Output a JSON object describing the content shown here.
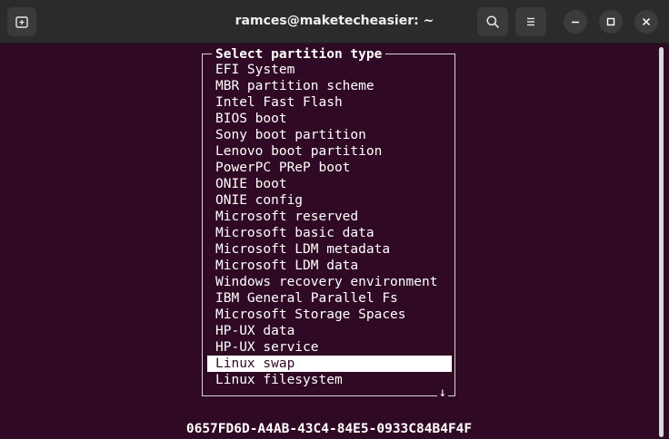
{
  "window": {
    "title": "ramces@maketecheasier: ~"
  },
  "toolbar": {
    "new_tab_icon": "new-tab-icon",
    "search_icon": "search-icon",
    "menu_icon": "hamburger-menu-icon",
    "minimize_icon": "minimize-icon",
    "maximize_icon": "maximize-icon",
    "close_icon": "close-icon"
  },
  "dialog": {
    "title": "Select partition type",
    "selected_index": 18,
    "items": [
      "EFI System",
      "MBR partition scheme",
      "Intel Fast Flash",
      "BIOS boot",
      "Sony boot partition",
      "Lenovo boot partition",
      "PowerPC PReP boot",
      "ONIE boot",
      "ONIE config",
      "Microsoft reserved",
      "Microsoft basic data",
      "Microsoft LDM metadata",
      "Microsoft LDM data",
      "Windows recovery environment",
      "IBM General Parallel Fs",
      "Microsoft Storage Spaces",
      "HP-UX data",
      "HP-UX service",
      "Linux swap",
      "Linux filesystem"
    ],
    "scroll_indicator": "↓"
  },
  "footer": {
    "uuid": "0657FD6D-A4AB-43C4-84E5-0933C84B4F4F"
  },
  "colors": {
    "terminal_bg": "#300a24",
    "titlebar_bg": "#2b2b2b",
    "text": "#ffffff"
  }
}
